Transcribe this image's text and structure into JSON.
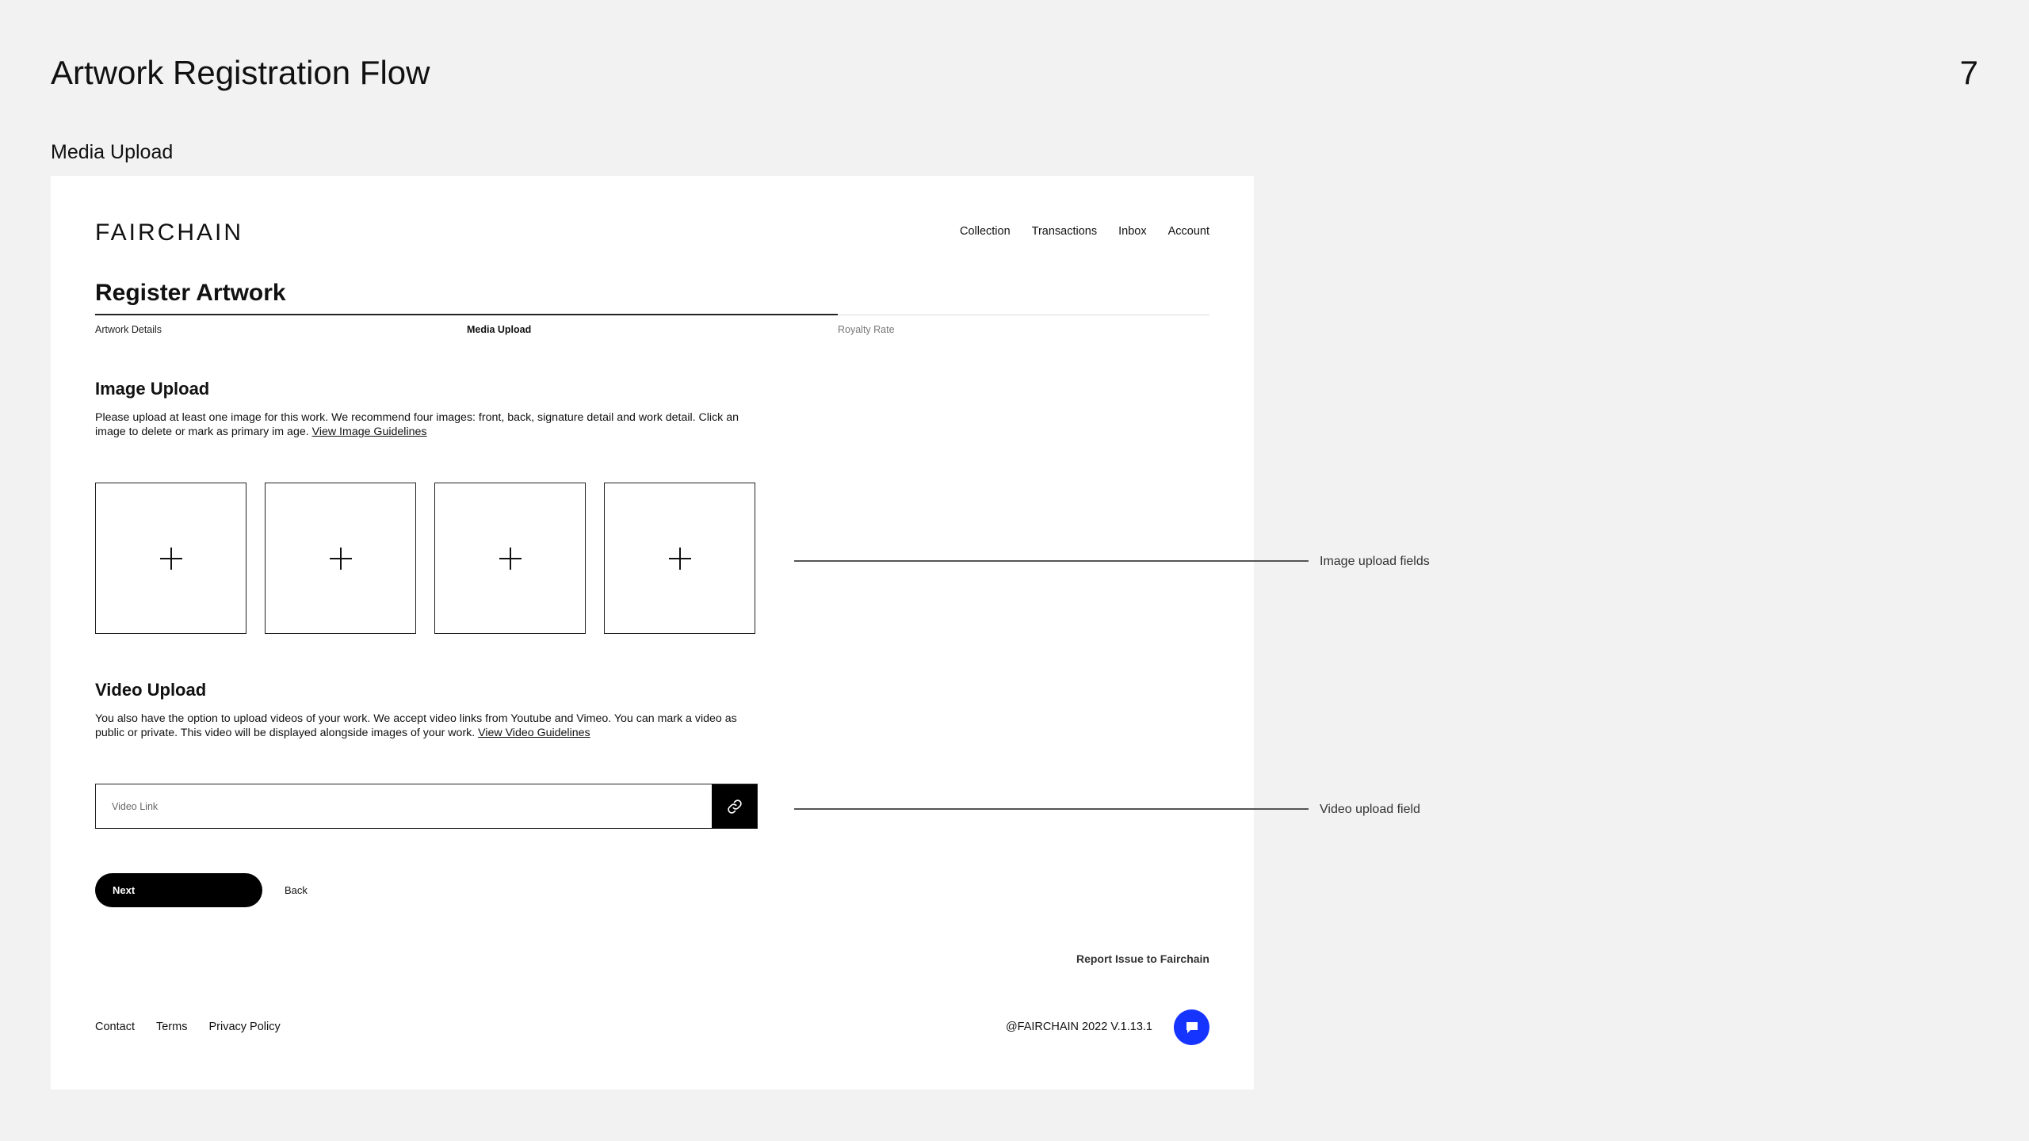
{
  "slide": {
    "title": "Artwork Registration Flow",
    "page_number": "7",
    "section_label": "Media Upload"
  },
  "header": {
    "logo": "FAIRCHAIN",
    "nav": [
      "Collection",
      "Transactions",
      "Inbox",
      "Account"
    ]
  },
  "main": {
    "heading": "Register Artwork",
    "steps": [
      "Artwork Details",
      "Media Upload",
      "Royalty Rate"
    ],
    "active_step": "Media Upload",
    "image_upload": {
      "title": "Image Upload",
      "description": "Please upload at least one image for this work. We recommend four images: front, back, signature detail and work detail. Click an image to delete or mark as primary im age.",
      "guidelines_link": "View Image Guidelines",
      "tile_icon": "plus-icon"
    },
    "video_upload": {
      "title": "Video Upload",
      "description": "You also have the option to upload videos of your work. We accept video links from Youtube and Vimeo. You can mark a video as public or private. This video will be displayed alongside images of your work.",
      "guidelines_link": "View Video Guidelines",
      "input_placeholder": "Video Link",
      "input_value": "",
      "button_icon": "link-icon"
    },
    "next_label": "Next",
    "back_label": "Back"
  },
  "footer": {
    "report_label": "Report Issue to Fairchain",
    "links": [
      "Contact",
      "Terms",
      "Privacy Policy"
    ],
    "copyright": "@FAIRCHAIN 2022 V.1.13.1",
    "chat_icon": "chat-icon",
    "chat_color": "#1634ff"
  },
  "annotations": {
    "image_fields": "Image upload fields",
    "video_field": "Video upload field"
  }
}
